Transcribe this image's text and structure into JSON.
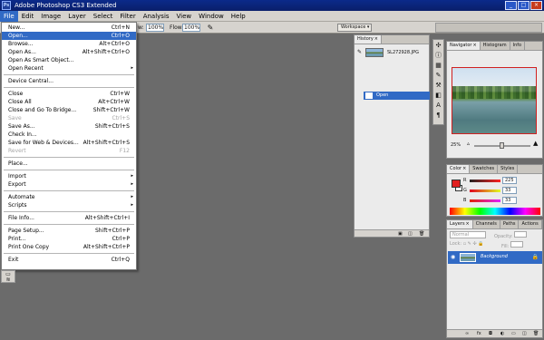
{
  "app": {
    "logo": "Ps",
    "title": "Adobe Photoshop CS3 Extended",
    "window_buttons": {
      "minimize": "_",
      "maximize": "□",
      "close": "×"
    }
  },
  "menubar": [
    "File",
    "Edit",
    "Image",
    "Layer",
    "Select",
    "Filter",
    "Analysis",
    "View",
    "Window",
    "Help"
  ],
  "options_bar": {
    "field_a_label": "w:",
    "field_a_value": "100%",
    "flow_label": "Flow:",
    "flow_value": "100%",
    "workspace_label": "Workspace ▾"
  },
  "file_menu": [
    {
      "label": "New...",
      "shortcut": "Ctrl+N"
    },
    {
      "label": "Open...",
      "shortcut": "Ctrl+O",
      "highlighted": true
    },
    {
      "label": "Browse...",
      "shortcut": "Alt+Ctrl+O"
    },
    {
      "label": "Open As...",
      "shortcut": "Alt+Shift+Ctrl+O"
    },
    {
      "label": "Open As Smart Object...",
      "shortcut": ""
    },
    {
      "label": "Open Recent",
      "shortcut": "",
      "submenu": true
    },
    {
      "sep": true
    },
    {
      "label": "Device Central...",
      "shortcut": ""
    },
    {
      "sep": true
    },
    {
      "label": "Close",
      "shortcut": "Ctrl+W"
    },
    {
      "label": "Close All",
      "shortcut": "Alt+Ctrl+W"
    },
    {
      "label": "Close and Go To Bridge...",
      "shortcut": "Shift+Ctrl+W"
    },
    {
      "label": "Save",
      "shortcut": "Ctrl+S",
      "disabled": true
    },
    {
      "label": "Save As...",
      "shortcut": "Shift+Ctrl+S"
    },
    {
      "label": "Check In...",
      "shortcut": ""
    },
    {
      "label": "Save for Web & Devices...",
      "shortcut": "Alt+Shift+Ctrl+S"
    },
    {
      "label": "Revert",
      "shortcut": "F12",
      "disabled": true
    },
    {
      "sep": true
    },
    {
      "label": "Place...",
      "shortcut": ""
    },
    {
      "sep": true
    },
    {
      "label": "Import",
      "shortcut": "",
      "submenu": true
    },
    {
      "label": "Export",
      "shortcut": "",
      "submenu": true
    },
    {
      "sep": true
    },
    {
      "label": "Automate",
      "shortcut": "",
      "submenu": true
    },
    {
      "label": "Scripts",
      "shortcut": "",
      "submenu": true
    },
    {
      "sep": true
    },
    {
      "label": "File Info...",
      "shortcut": "Alt+Shift+Ctrl+I"
    },
    {
      "sep": true
    },
    {
      "label": "Page Setup...",
      "shortcut": "Shift+Ctrl+P"
    },
    {
      "label": "Print...",
      "shortcut": "Ctrl+P"
    },
    {
      "label": "Print One Copy",
      "shortcut": "Alt+Shift+Ctrl+P"
    },
    {
      "sep": true
    },
    {
      "label": "Exit",
      "shortcut": "Ctrl+Q"
    }
  ],
  "history": {
    "tab": "History",
    "snapshot_name": "SL272928.JPG",
    "state_label": "Open"
  },
  "navigator": {
    "tabs": [
      "Navigator",
      "Histogram",
      "Info"
    ],
    "zoom": "25%"
  },
  "color": {
    "tabs": [
      "Color",
      "Swatches",
      "Styles"
    ],
    "channels": [
      {
        "name": "R",
        "value": "225"
      },
      {
        "name": "G",
        "value": "33"
      },
      {
        "name": "B",
        "value": "33"
      }
    ],
    "foreground": "#e12121"
  },
  "layers": {
    "tabs": [
      "Layers",
      "Channels",
      "Paths",
      "Actions"
    ],
    "blend_mode": "Normal",
    "opacity_label": "Opacity:",
    "lock_label": "Lock:",
    "fill_label": "Fill:",
    "layer_name": "Background"
  },
  "colors": {
    "title_bar": "#0b2a8a",
    "highlight": "#316ac5",
    "workspace_bg": "#6b6b6b",
    "chrome": "#d6d3ce"
  }
}
